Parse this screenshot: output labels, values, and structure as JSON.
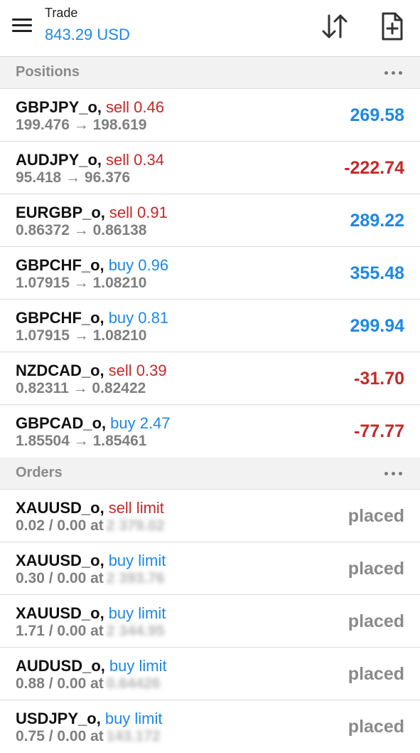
{
  "header": {
    "title": "Trade",
    "balance": "843.29 USD"
  },
  "icons": {
    "menu": "hamburger-menu-icon",
    "sort": "sort-arrows-icon",
    "new_order": "new-document-plus-icon"
  },
  "colors": {
    "accent_blue": "#1e88e5",
    "loss_red": "#c62828",
    "muted_gray": "#8a8a8a"
  },
  "positions": {
    "title": "Positions",
    "items": [
      {
        "symbol": "GBPJPY_o,",
        "side": "sell 0.46",
        "prices": "199.476 → 198.619",
        "profit": "269.58"
      },
      {
        "symbol": "AUDJPY_o,",
        "side": "sell 0.34",
        "prices": "95.418 → 96.376",
        "profit": "-222.74"
      },
      {
        "symbol": "EURGBP_o,",
        "side": "sell 0.91",
        "prices": "0.86372 → 0.86138",
        "profit": "289.22"
      },
      {
        "symbol": "GBPCHF_o,",
        "side": "buy 0.96",
        "prices": "1.07915 → 1.08210",
        "profit": "355.48"
      },
      {
        "symbol": "GBPCHF_o,",
        "side": "buy 0.81",
        "prices": "1.07915 → 1.08210",
        "profit": "299.94"
      },
      {
        "symbol": "NZDCAD_o,",
        "side": "sell 0.39",
        "prices": "0.82311 → 0.82422",
        "profit": "-31.70"
      },
      {
        "symbol": "GBPCAD_o,",
        "side": "buy 2.47",
        "prices": "1.85504 → 1.85461",
        "profit": "-77.77"
      }
    ]
  },
  "orders": {
    "title": "Orders",
    "items": [
      {
        "symbol": "XAUUSD_o,",
        "type": "sell limit",
        "volume": "0.02 / 0.00 at",
        "price": "2 379.02",
        "status": "placed"
      },
      {
        "symbol": "XAUUSD_o,",
        "type": "buy limit",
        "volume": "0.30 / 0.00 at",
        "price": "2 393.76",
        "status": "placed"
      },
      {
        "symbol": "XAUUSD_o,",
        "type": "buy limit",
        "volume": "1.71 / 0.00 at",
        "price": "2 344.95",
        "status": "placed"
      },
      {
        "symbol": "AUDUSD_o,",
        "type": "buy limit",
        "volume": "0.88 / 0.00 at",
        "price": "0.64426",
        "status": "placed"
      },
      {
        "symbol": "USDJPY_o,",
        "type": "buy limit",
        "volume": "0.75 / 0.00 at",
        "price": "143.172",
        "status": "placed"
      }
    ]
  }
}
